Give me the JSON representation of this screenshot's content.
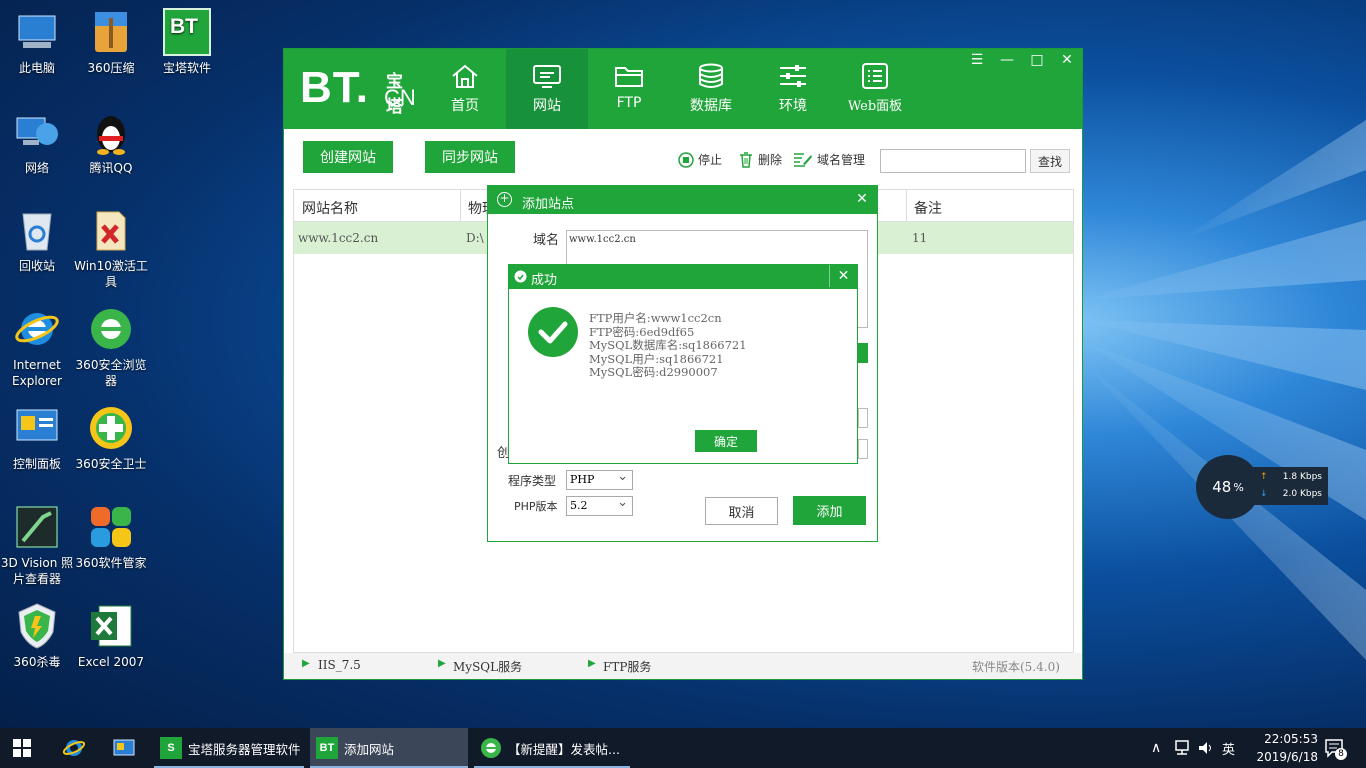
{
  "desktop": {
    "icons": [
      {
        "label": "此电脑"
      },
      {
        "label": "360压缩"
      },
      {
        "label": "宝塔软件"
      },
      {
        "label": "网络"
      },
      {
        "label": "腾讯QQ"
      },
      {
        "label": "回收站"
      },
      {
        "label": "Win10激活工具"
      },
      {
        "label": "Internet Explorer"
      },
      {
        "label": "360安全浏览器"
      },
      {
        "label": "控制面板"
      },
      {
        "label": "360安全卫士"
      },
      {
        "label": "3D Vision 照片查看器"
      },
      {
        "label": "360软件管家"
      },
      {
        "label": "360杀毒"
      },
      {
        "label": "Excel 2007"
      }
    ],
    "bt_shortcut_text": "BT"
  },
  "bt_window": {
    "logo_main": "BT.",
    "logo_cn_top": "宝塔",
    "logo_cn_bottom": "CN",
    "nav": [
      {
        "label": "首页",
        "icon": "home-icon"
      },
      {
        "label": "网站",
        "icon": "website-icon",
        "active": true
      },
      {
        "label": "FTP",
        "icon": "folder-icon"
      },
      {
        "label": "数据库",
        "icon": "database-icon"
      },
      {
        "label": "环境",
        "icon": "sliders-icon"
      },
      {
        "label": "Web面板",
        "icon": "panel-icon"
      }
    ],
    "toolbar": {
      "create_site": "创建网站",
      "sync_site": "同步网站",
      "stop": "停止",
      "delete": "删除",
      "domain_manage": "域名管理",
      "search_value": "",
      "search_btn": "查找"
    },
    "table": {
      "headers": [
        "网站名称",
        "物理",
        "备注"
      ],
      "rows": [
        {
          "name": "www.1cc2.cn",
          "path": "D:\\",
          "note": "11"
        }
      ]
    },
    "status": {
      "iis": "IIS_7.5",
      "mysql": "MySQL服务",
      "ftp": "FTP服务",
      "version": "软件版本(5.4.0)"
    }
  },
  "add_dialog": {
    "title": "添加站点",
    "domain_label": "域名",
    "domain_value": "www.1cc2.cn",
    "create_label_partial": "创",
    "prog_type_label": "程序类型",
    "prog_type_value": "PHP",
    "php_version_label": "PHP版本",
    "php_version_value": "5.2",
    "cancel": "取消",
    "add": "添加"
  },
  "success_dialog": {
    "title": "成功",
    "lines": [
      "FTP用户名:www1cc2cn",
      "FTP密码:6ed9df65",
      "MySQL数据库名:sq1866721",
      "MySQL用户:sq1866721",
      "MySQL密码:d2990007"
    ],
    "ok": "确定"
  },
  "net_widget": {
    "percent": "48",
    "percent_sign": "%",
    "up": "1.8 Kbps",
    "down": "2.0 Kbps"
  },
  "taskbar": {
    "apps": [
      {
        "label": "宝塔服务器管理软件",
        "icon_text": "S"
      },
      {
        "label": "添加网站",
        "icon_text": "BT"
      },
      {
        "label": "【新提醒】发表帖..."
      }
    ],
    "ime": "英",
    "time": "22:05:53",
    "date": "2019/6/18",
    "notif_count": "8"
  }
}
